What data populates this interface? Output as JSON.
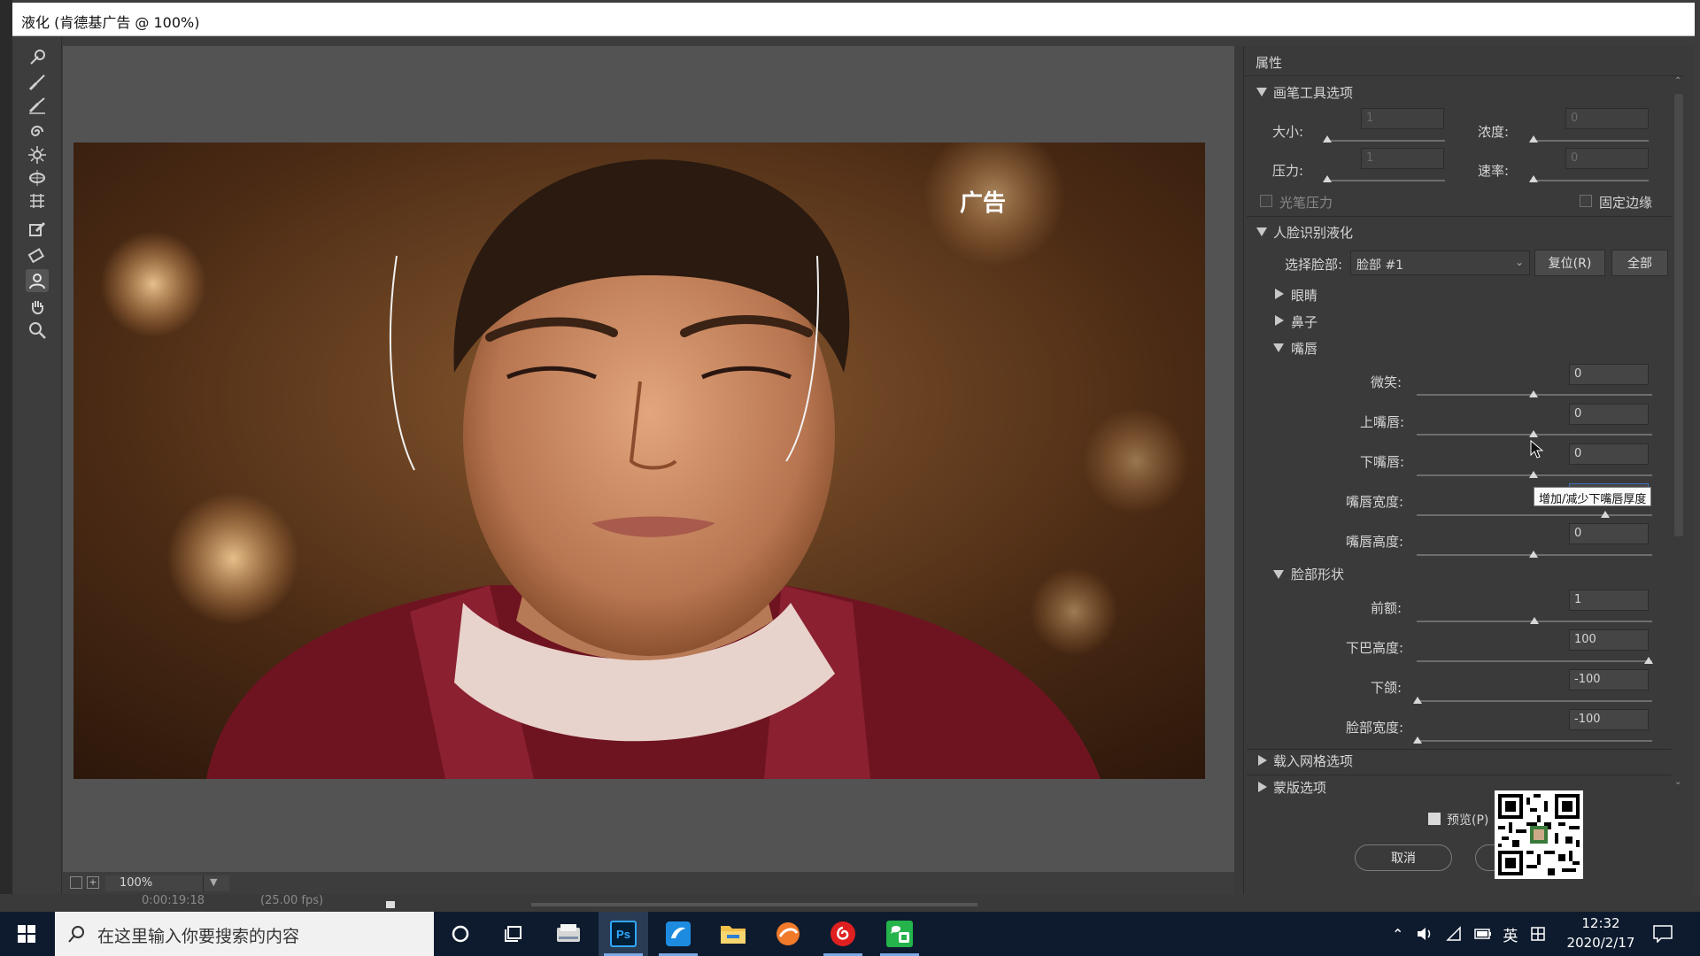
{
  "window": {
    "title": "液化 (肯德基广告 @ 100%)"
  },
  "tools": [
    "forward-warp",
    "reconstruct",
    "smooth",
    "twirl",
    "pucker",
    "bloat",
    "push-left",
    "freeze-mask",
    "thaw-mask",
    "face-tool",
    "hand",
    "zoom"
  ],
  "canvas": {
    "overlay_text": "广告",
    "zoom": "100%",
    "status_left": "0:00:19:18",
    "status_right": "(25.00 fps)"
  },
  "properties": {
    "title": "属性",
    "brush_section": {
      "title": "画笔工具选项",
      "size_label": "大小:",
      "size_value": "1",
      "density_label": "浓度:",
      "density_value": "0",
      "pressure_label": "压力:",
      "pressure_value": "1",
      "rate_label": "速率:",
      "rate_value": "0",
      "stylus_label": "光笔压力",
      "pin_edges_label": "固定边缘"
    },
    "face_section": {
      "title": "人脸识别液化",
      "select_face_label": "选择脸部:",
      "select_face_value": "脸部 #1",
      "reset_label": "复位(R)",
      "all_label": "全部",
      "eyes_label": "眼睛",
      "nose_label": "鼻子",
      "mouth_label": "嘴唇",
      "mouth_sliders": [
        {
          "label": "微笑:",
          "value": "0"
        },
        {
          "label": "上嘴唇:",
          "value": "0"
        },
        {
          "label": "下嘴唇:",
          "value": "0"
        },
        {
          "label": "嘴唇宽度:",
          "value": ""
        },
        {
          "label": "嘴唇高度:",
          "value": "0"
        }
      ],
      "face_shape_label": "脸部形状",
      "face_sliders": [
        {
          "label": "前额:",
          "value": "1"
        },
        {
          "label": "下巴高度:",
          "value": "100"
        },
        {
          "label": "下颌:",
          "value": "-100"
        },
        {
          "label": "脸部宽度:",
          "value": "-100"
        }
      ]
    },
    "load_mesh_label": "载入网格选项",
    "mask_label": "蒙版选项",
    "preview_label": "预览(P)",
    "cancel_label": "取消",
    "tooltip": "增加/减少下嘴唇厚度"
  },
  "taskbar": {
    "search_placeholder": "在这里输入你要搜索的内容",
    "ime_label": "英",
    "time": "12:32",
    "date": "2020/2/17"
  }
}
